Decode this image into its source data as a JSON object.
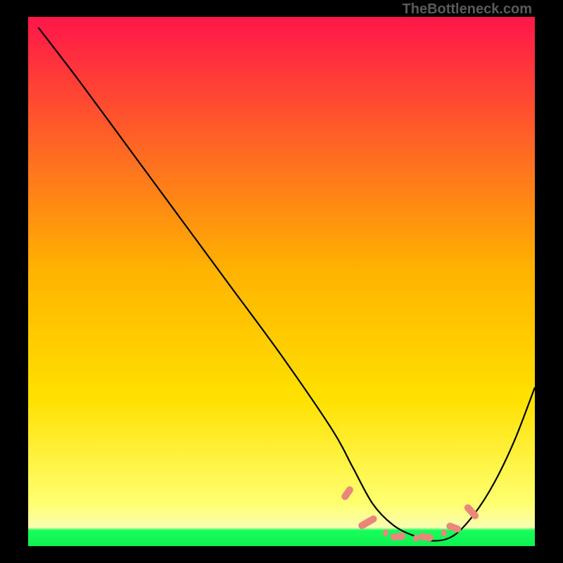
{
  "watermark": "TheBottleneck.com",
  "chart_data": {
    "type": "line",
    "title": "",
    "xlabel": "",
    "ylabel": "",
    "xlim": [
      0,
      100
    ],
    "ylim": [
      0,
      100
    ],
    "grid": false,
    "series": [
      {
        "name": "curve",
        "color": "#000000",
        "x": [
          2,
          10,
          20,
          30,
          40,
          50,
          60,
          64,
          68,
          72,
          76,
          80,
          84,
          88,
          92,
          96,
          100
        ],
        "y": [
          98,
          88,
          75,
          62,
          49,
          36,
          22,
          15,
          8,
          4,
          2,
          1,
          2,
          6,
          12,
          20,
          30
        ]
      }
    ],
    "markers": {
      "description": "irregular salmon dash-dot markers near the curve minimum",
      "color": "#e9877c",
      "points": [
        {
          "x": 63,
          "y": 10,
          "len": 3,
          "angle": -55
        },
        {
          "x": 67,
          "y": 4.5,
          "len": 4,
          "angle": -30
        },
        {
          "x": 70.5,
          "y": 2.5,
          "len": 1,
          "angle": 0
        },
        {
          "x": 73,
          "y": 1.8,
          "len": 3,
          "angle": -5
        },
        {
          "x": 76.5,
          "y": 1.5,
          "len": 1,
          "angle": 0
        },
        {
          "x": 78.5,
          "y": 1.7,
          "len": 3,
          "angle": 8
        },
        {
          "x": 82,
          "y": 2.5,
          "len": 1,
          "angle": 0
        },
        {
          "x": 84,
          "y": 3.5,
          "len": 3,
          "angle": 20
        },
        {
          "x": 87.5,
          "y": 6.5,
          "len": 3.5,
          "angle": 48
        }
      ]
    },
    "background_gradient": {
      "top": "#ff164a",
      "mid": "#ffd400",
      "low": "#ffff66",
      "bottom_band": "#16ff5a"
    }
  }
}
